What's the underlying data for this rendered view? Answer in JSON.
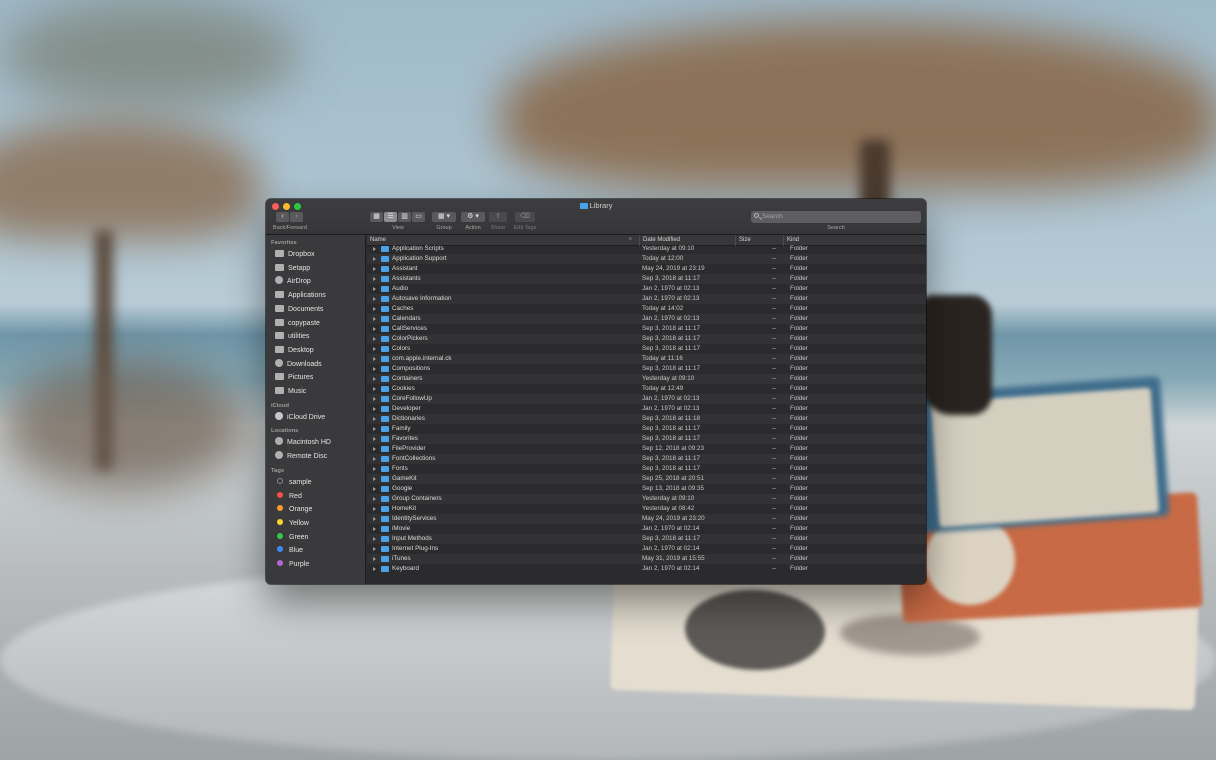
{
  "window": {
    "title": "Library"
  },
  "toolbar": {
    "back_forward_label": "Back/Forward",
    "view_label": "View",
    "group_label": "Group",
    "action_label": "Action",
    "share_label": "Share",
    "edit_tags_label": "Edit Tags",
    "search_label": "Search",
    "search_placeholder": "Search"
  },
  "sidebar": {
    "favorites_header": "Favorites",
    "favorites": [
      "Dropbox",
      "Setapp",
      "AirDrop",
      "Applications",
      "Documents",
      "copypaste",
      "utilities",
      "Desktop",
      "Downloads",
      "Pictures",
      "Music"
    ],
    "icloud_header": "iCloud",
    "icloud": [
      "iCloud Drive"
    ],
    "locations_header": "Locations",
    "locations": [
      "Macintosh HD",
      "Remote Disc"
    ],
    "tags_header": "Tags",
    "tags": [
      {
        "label": "sample",
        "color": "#8e8e8e"
      },
      {
        "label": "Red",
        "color": "#fc4e48"
      },
      {
        "label": "Orange",
        "color": "#fd9a2a"
      },
      {
        "label": "Yellow",
        "color": "#fdd42f"
      },
      {
        "label": "Green",
        "color": "#34c94a"
      },
      {
        "label": "Blue",
        "color": "#3a8cf0"
      },
      {
        "label": "Purple",
        "color": "#b866d6"
      }
    ]
  },
  "columns": {
    "name": "Name",
    "date": "Date Modified",
    "size": "Size",
    "kind": "Kind"
  },
  "rows": [
    {
      "name": "Application Scripts",
      "date": "Yesterday at 09:10",
      "size": "--",
      "kind": "Folder"
    },
    {
      "name": "Application Support",
      "date": "Today at 12:00",
      "size": "--",
      "kind": "Folder"
    },
    {
      "name": "Assistant",
      "date": "May 24, 2019 at 23:19",
      "size": "--",
      "kind": "Folder"
    },
    {
      "name": "Assistants",
      "date": "Sep 3, 2018 at 11:17",
      "size": "--",
      "kind": "Folder"
    },
    {
      "name": "Audio",
      "date": "Jan 2, 1970 at 02:13",
      "size": "--",
      "kind": "Folder"
    },
    {
      "name": "Autosave Information",
      "date": "Jan 2, 1970 at 02:13",
      "size": "--",
      "kind": "Folder"
    },
    {
      "name": "Caches",
      "date": "Today at 14:02",
      "size": "--",
      "kind": "Folder"
    },
    {
      "name": "Calendars",
      "date": "Jan 2, 1970 at 02:13",
      "size": "--",
      "kind": "Folder"
    },
    {
      "name": "CallServices",
      "date": "Sep 3, 2018 at 11:17",
      "size": "--",
      "kind": "Folder"
    },
    {
      "name": "ColorPickers",
      "date": "Sep 3, 2018 at 11:17",
      "size": "--",
      "kind": "Folder"
    },
    {
      "name": "Colors",
      "date": "Sep 3, 2018 at 11:17",
      "size": "--",
      "kind": "Folder"
    },
    {
      "name": "com.apple.internal.ck",
      "date": "Today at 11:16",
      "size": "--",
      "kind": "Folder"
    },
    {
      "name": "Compositions",
      "date": "Sep 3, 2018 at 11:17",
      "size": "--",
      "kind": "Folder"
    },
    {
      "name": "Containers",
      "date": "Yesterday at 09:10",
      "size": "--",
      "kind": "Folder"
    },
    {
      "name": "Cookies",
      "date": "Today at 12:49",
      "size": "--",
      "kind": "Folder"
    },
    {
      "name": "CoreFollowUp",
      "date": "Jan 2, 1970 at 02:13",
      "size": "--",
      "kind": "Folder"
    },
    {
      "name": "Developer",
      "date": "Jan 2, 1970 at 02:13",
      "size": "--",
      "kind": "Folder"
    },
    {
      "name": "Dictionaries",
      "date": "Sep 3, 2018 at 11:18",
      "size": "--",
      "kind": "Folder"
    },
    {
      "name": "Family",
      "date": "Sep 3, 2018 at 11:17",
      "size": "--",
      "kind": "Folder"
    },
    {
      "name": "Favorites",
      "date": "Sep 3, 2018 at 11:17",
      "size": "--",
      "kind": "Folder"
    },
    {
      "name": "FileProvider",
      "date": "Sep 12, 2018 at 09:23",
      "size": "--",
      "kind": "Folder"
    },
    {
      "name": "FontCollections",
      "date": "Sep 3, 2018 at 11:17",
      "size": "--",
      "kind": "Folder"
    },
    {
      "name": "Fonts",
      "date": "Sep 3, 2018 at 11:17",
      "size": "--",
      "kind": "Folder"
    },
    {
      "name": "GameKit",
      "date": "Sep 25, 2018 at 20:51",
      "size": "--",
      "kind": "Folder"
    },
    {
      "name": "Google",
      "date": "Sep 13, 2018 at 09:35",
      "size": "--",
      "kind": "Folder"
    },
    {
      "name": "Group Containers",
      "date": "Yesterday at 09:10",
      "size": "--",
      "kind": "Folder"
    },
    {
      "name": "HomeKit",
      "date": "Yesterday at 08:42",
      "size": "--",
      "kind": "Folder"
    },
    {
      "name": "IdentityServices",
      "date": "May 24, 2019 at 23:20",
      "size": "--",
      "kind": "Folder"
    },
    {
      "name": "iMovie",
      "date": "Jan 2, 1970 at 02:14",
      "size": "--",
      "kind": "Folder"
    },
    {
      "name": "Input Methods",
      "date": "Sep 3, 2018 at 11:17",
      "size": "--",
      "kind": "Folder"
    },
    {
      "name": "Internet Plug-Ins",
      "date": "Jan 2, 1970 at 02:14",
      "size": "--",
      "kind": "Folder"
    },
    {
      "name": "iTunes",
      "date": "May 31, 2019 at 15:55",
      "size": "--",
      "kind": "Folder"
    },
    {
      "name": "Keyboard",
      "date": "Jan 2, 1970 at 02:14",
      "size": "--",
      "kind": "Folder"
    }
  ]
}
